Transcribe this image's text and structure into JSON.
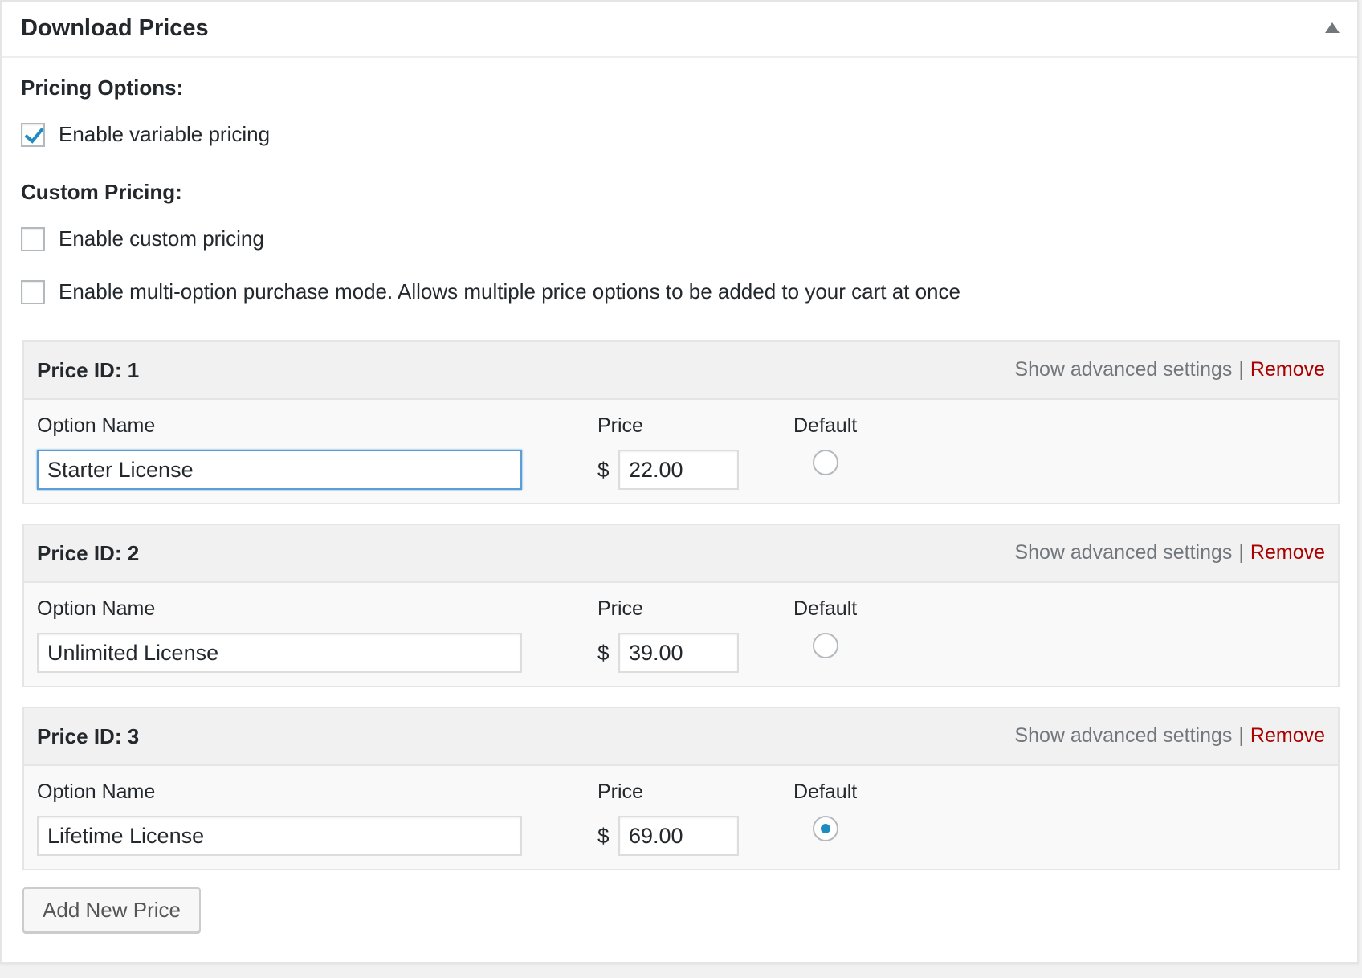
{
  "metabox": {
    "title": "Download Prices"
  },
  "pricing_options": {
    "label": "Pricing Options:",
    "variable_pricing": {
      "label": "Enable variable pricing",
      "checked": true
    }
  },
  "custom_pricing": {
    "label": "Custom Pricing:",
    "custom": {
      "label": "Enable custom pricing",
      "checked": false
    },
    "multi_option": {
      "label": "Enable multi-option purchase mode. Allows multiple price options to be added to your cart at once",
      "checked": false
    }
  },
  "prices": [
    {
      "id_label": "Price ID: 1",
      "advanced_label": "Show advanced settings",
      "separator": "|",
      "remove_label": "Remove",
      "option_name_label": "Option Name",
      "option_name": "Starter License",
      "price_label": "Price",
      "currency": "$",
      "price": "22.00",
      "default_label": "Default",
      "is_default": false
    },
    {
      "id_label": "Price ID: 2",
      "advanced_label": "Show advanced settings",
      "separator": "|",
      "remove_label": "Remove",
      "option_name_label": "Option Name",
      "option_name": "Unlimited License",
      "price_label": "Price",
      "currency": "$",
      "price": "39.00",
      "default_label": "Default",
      "is_default": false
    },
    {
      "id_label": "Price ID: 3",
      "advanced_label": "Show advanced settings",
      "separator": "|",
      "remove_label": "Remove",
      "option_name_label": "Option Name",
      "option_name": "Lifetime License",
      "price_label": "Price",
      "currency": "$",
      "price": "69.00",
      "default_label": "Default",
      "is_default": true
    }
  ],
  "add_button_label": "Add New Price",
  "colors": {
    "accent": "#1e8cbe",
    "remove": "#aa0000",
    "focus_border": "#5b9dd9"
  },
  "icons": {
    "toggle": "triangle-up-icon",
    "check": "checkmark-icon"
  }
}
